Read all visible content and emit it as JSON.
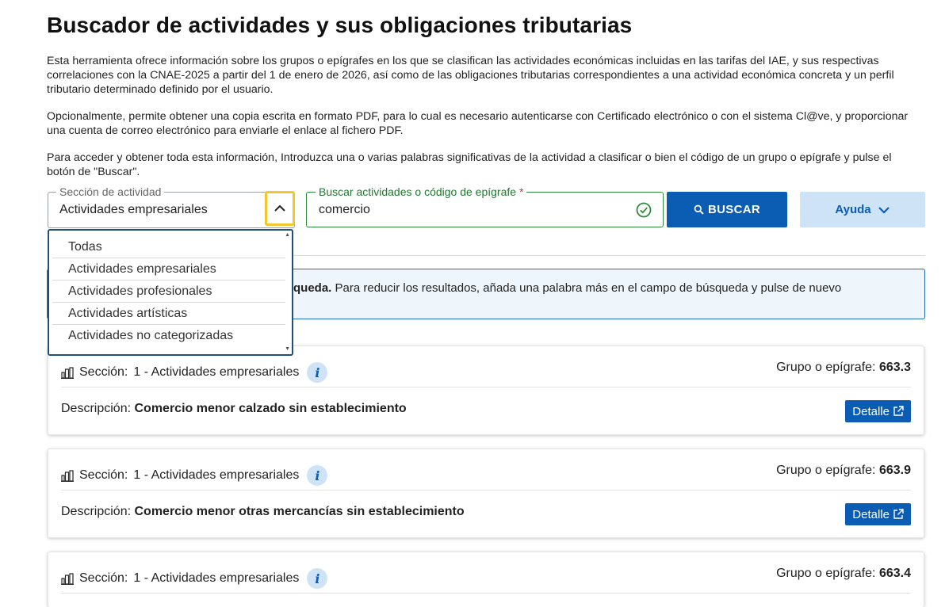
{
  "page_title": "Buscador de actividades y sus obligaciones tributarias",
  "intro": {
    "p1": "Esta herramienta ofrece información sobre los grupos o epígrafes en los que se clasifican las actividades económicas incluidas en las tarifas del IAE, y sus respectivas correlaciones con la CNAE-2025 a partir del 1 de enero de 2026, así como de las obligaciones tributarias correspondientes a una actividad económica concreta y un perfil tributario determinado definido por el usuario.",
    "p2": "Opcionalmente, permite obtener una copia escrita en formato PDF, para lo cual es necesario autenticarse con Certificado electrónico o con el sistema Cl@ve, y proporcionar una cuenta de correo electrónico para enviarle el enlace al fichero PDF.",
    "p3": "Para acceder y obtener toda esta información, Introduzca una o varias palabras significativas de la actividad a clasificar o bien el código de un grupo o epígrafe y pulse el botón de \"Buscar\"."
  },
  "section_select": {
    "label": "Sección de actividad",
    "value": "Actividades empresariales",
    "options": [
      "Todas",
      "Actividades empresariales",
      "Actividades profesionales",
      "Actividades artísticas",
      "Actividades no categorizadas"
    ]
  },
  "search": {
    "label": "Buscar actividades o código de epígrafe",
    "required_mark": "*",
    "value": "comercio"
  },
  "buttons": {
    "buscar": "BUSCAR",
    "ayuda": "Ayuda"
  },
  "alert": {
    "bold": "queda.",
    "text": " Para reducir los resultados, añada una palabra más en el campo de búsqueda y pulse de nuevo"
  },
  "results": [
    {
      "section_label": "Sección:",
      "section_value": "1 - Actividades empresariales",
      "grupo_label": "Grupo o epígrafe:",
      "grupo_value": "663.3",
      "desc_label": "Descripción:",
      "desc_value": "Comercio menor calzado sin establecimiento",
      "button": "Detalle"
    },
    {
      "section_label": "Sección:",
      "section_value": "1 - Actividades empresariales",
      "grupo_label": "Grupo o epígrafe:",
      "grupo_value": "663.9",
      "desc_label": "Descripción:",
      "desc_value": "Comercio menor otras mercancías sin establecimiento",
      "button": "Detalle"
    },
    {
      "section_label": "Sección:",
      "section_value": "1 - Actividades empresariales",
      "grupo_label": "Grupo o epígrafe:",
      "grupo_value": "663.4",
      "desc_label": "",
      "desc_value": "",
      "button": ""
    }
  ],
  "colors": {
    "primary": "#0b5cb3",
    "success": "#2e8b3a",
    "focus": "#f2c62f",
    "light_blue": "#cfe3f7"
  }
}
